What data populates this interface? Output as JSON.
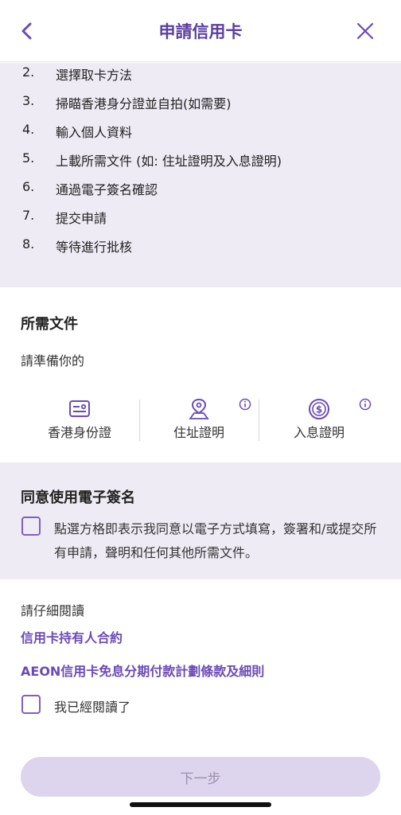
{
  "header": {
    "title": "申請信用卡",
    "back_icon": "chevron-left-icon",
    "close_icon": "close-icon",
    "accent_color": "#5b3fa0"
  },
  "steps": [
    {
      "num": "2.",
      "text": "選擇取卡方法"
    },
    {
      "num": "3.",
      "text": "掃瞄香港身分證並自拍(如需要)"
    },
    {
      "num": "4.",
      "text": "輸入個人資料"
    },
    {
      "num": "5.",
      "text": "上載所需文件 (如: 住址證明及入息證明)"
    },
    {
      "num": "6.",
      "text": "通過電子簽名確認"
    },
    {
      "num": "7.",
      "text": "提交申請"
    },
    {
      "num": "8.",
      "text": "等待進行批核"
    }
  ],
  "documents": {
    "title": "所需文件",
    "subtitle": "請準備你的",
    "items": [
      {
        "label": "香港身份證",
        "icon": "id-card-icon"
      },
      {
        "label": "住址證明",
        "icon": "address-pin-icon"
      },
      {
        "label": "入息證明",
        "icon": "dollar-coin-icon"
      }
    ]
  },
  "consent": {
    "title": "同意使用電子簽名",
    "text": "點選方格即表示我同意以電子方式填寫，簽署和/或提交所有申請，聲明和任何其他所需文件。"
  },
  "reading": {
    "label": "請仔細閱讀",
    "link1": "信用卡持有人合約",
    "link2": "AEON信用卡免息分期付款計劃條款及細則",
    "confirm": "我已經閱讀了"
  },
  "footer": {
    "next_label": "下一步"
  }
}
